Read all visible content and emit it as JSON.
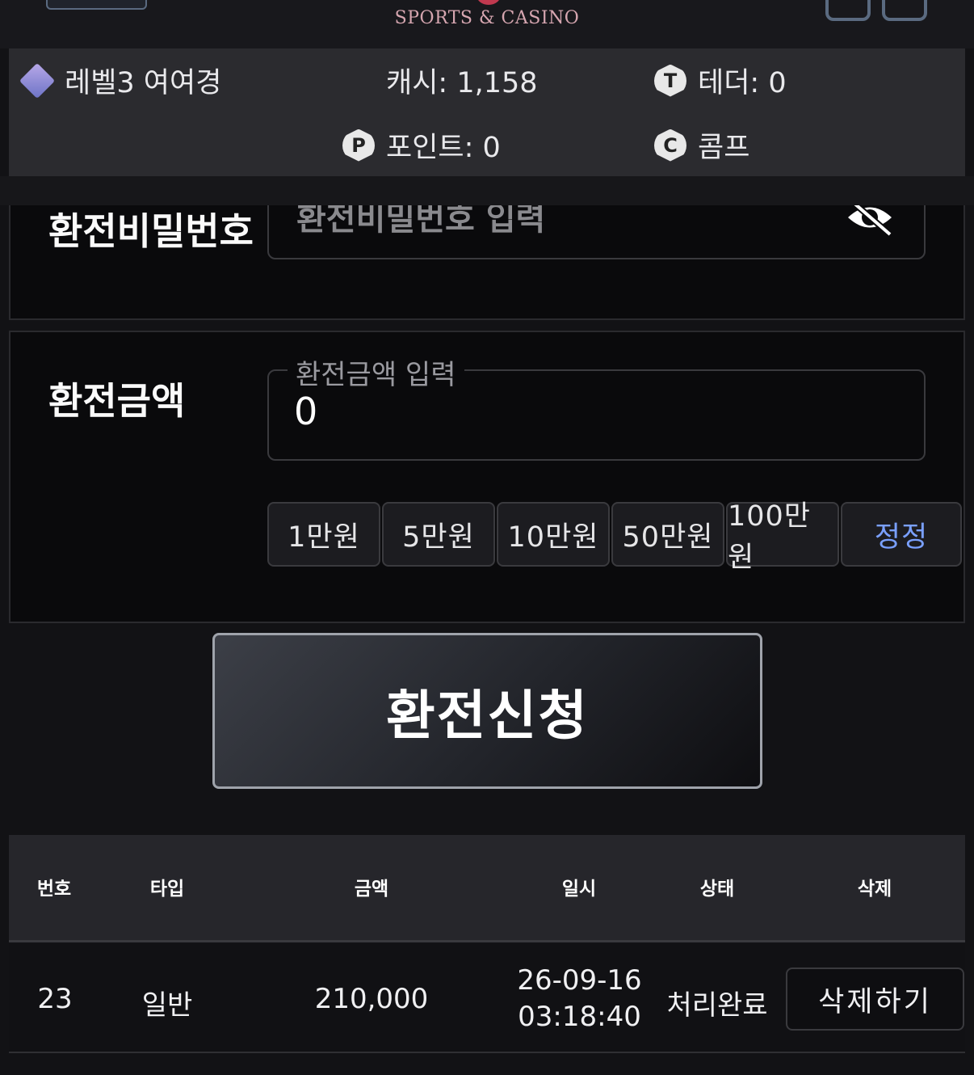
{
  "header": {
    "brand": "SPORTS & CASINO"
  },
  "infobar": {
    "level": "레벨3 여여경",
    "cash": "캐시: 1,158",
    "tether": "테더: 0",
    "points": "포인트: 0",
    "comp": "콤프",
    "icons": {
      "level": "level-icon",
      "tether": "T",
      "points": "P",
      "comp": "C"
    }
  },
  "password_section": {
    "label": "환전비밀번호",
    "placeholder": "환전비밀번호 입력"
  },
  "amount_section": {
    "label": "환전금액",
    "input_legend": "환전금액 입력",
    "value": "0",
    "quick_buttons": [
      "1만원",
      "5만원",
      "10만원",
      "50만원",
      "100만원"
    ],
    "reset_label": "정정"
  },
  "submit_label": "환전신청",
  "table": {
    "headers": [
      "번호",
      "타입",
      "금액",
      "일시",
      "상태",
      "삭제"
    ],
    "rows": [
      {
        "number": "23",
        "type": "일반",
        "amount": "210,000",
        "date": "26-09-16",
        "time": "03:18:40",
        "status": "처리완료",
        "delete_label": "삭제하기"
      }
    ]
  },
  "colors": {
    "background": "#121215",
    "panel": "#0a0a0c",
    "infobar": "#2b2b2f",
    "reset_accent": "#7aa0ff",
    "brand": "#d6a6b0"
  }
}
